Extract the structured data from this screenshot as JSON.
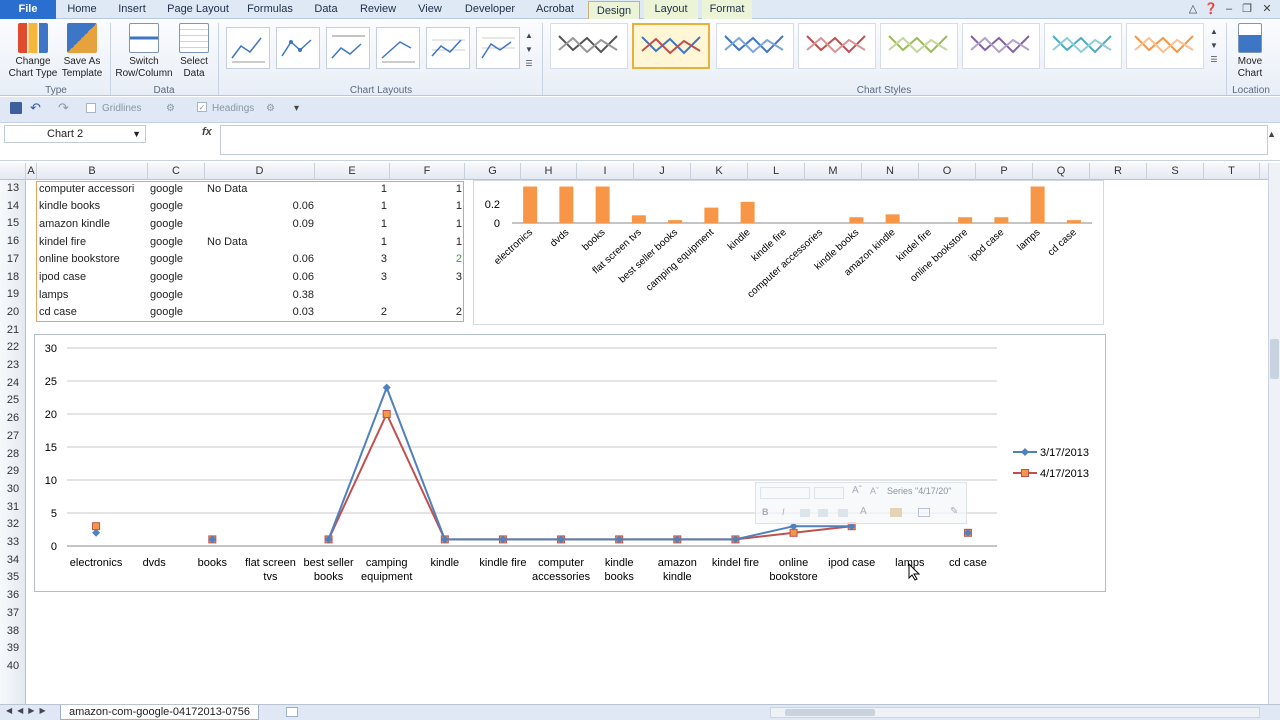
{
  "ribbon": {
    "tabs": [
      "File",
      "Home",
      "Insert",
      "Page Layout",
      "Formulas",
      "Data",
      "Review",
      "View",
      "Developer",
      "Acrobat",
      "Design",
      "Layout",
      "Format"
    ],
    "active_tab": "Design",
    "type_group": {
      "label": "Type",
      "change_chart_type": "Change Chart Type",
      "save_as_template": "Save As Template"
    },
    "data_group": {
      "label": "Data",
      "switch_row_column": "Switch Row/Column",
      "select_data": "Select Data"
    },
    "chart_layouts_label": "Chart Layouts",
    "chart_styles_label": "Chart Styles",
    "location_group": {
      "label": "Location",
      "move_chart": "Move Chart"
    }
  },
  "qat": {
    "gridlines": "Gridlines",
    "headings": "Headings"
  },
  "formula_bar": {
    "name_box": "Chart 2",
    "fx": "fx"
  },
  "columns": [
    "A",
    "B",
    "C",
    "D",
    "E",
    "F",
    "G",
    "H",
    "I",
    "J",
    "K",
    "L",
    "M",
    "N",
    "O",
    "P",
    "Q",
    "R",
    "S",
    "T"
  ],
  "rows": [
    "13",
    "14",
    "15",
    "16",
    "17",
    "18",
    "19",
    "20",
    "21",
    "22",
    "23",
    "24",
    "25",
    "26",
    "27",
    "28",
    "29",
    "30",
    "31",
    "32",
    "33",
    "34",
    "35",
    "36",
    "37",
    "38",
    "39",
    "40"
  ],
  "table": [
    {
      "b": "computer accessori",
      "c": "google",
      "d_text": "No Data",
      "d": "",
      "e": "1",
      "f": "1"
    },
    {
      "b": "kindle books",
      "c": "google",
      "d_text": "",
      "d": "0.06",
      "e": "1",
      "f": "1"
    },
    {
      "b": "amazon kindle",
      "c": "google",
      "d_text": "",
      "d": "0.09",
      "e": "1",
      "f": "1"
    },
    {
      "b": "kindel fire",
      "c": "google",
      "d_text": "No Data",
      "d": "",
      "e": "1",
      "f": "1"
    },
    {
      "b": "online bookstore",
      "c": "google",
      "d_text": "",
      "d": "0.06",
      "e": "3",
      "f": "2"
    },
    {
      "b": "ipod case",
      "c": "google",
      "d_text": "",
      "d": "0.06",
      "e": "3",
      "f": "3"
    },
    {
      "b": "lamps",
      "c": "google",
      "d_text": "",
      "d": "0.38",
      "e": "",
      "f": ""
    },
    {
      "b": "cd case",
      "c": "google",
      "d_text": "",
      "d": "0.03",
      "e": "2",
      "f": "2"
    }
  ],
  "chart_data": [
    {
      "type": "bar",
      "categories": [
        "electronics",
        "dvds",
        "books",
        "flat screen tvs",
        "best seller books",
        "camping equipment",
        "kindle",
        "kindle fire",
        "computer accessories",
        "kindle books",
        "amazon kindle",
        "kindel fire",
        "online bookstore",
        "ipod case",
        "lamps",
        "cd case"
      ],
      "values": [
        0.38,
        0.38,
        0.38,
        0.08,
        0.03,
        0.16,
        0.22,
        0,
        0,
        0.06,
        0.09,
        0,
        0.06,
        0.06,
        0.38,
        0.03
      ],
      "ylim": [
        0,
        0.25
      ],
      "yticks": [
        "0",
        "0.2"
      ],
      "color": "#f79646"
    },
    {
      "type": "line",
      "categories": [
        "electronics",
        "dvds",
        "books",
        "flat screen tvs",
        "best seller books",
        "camping equipment",
        "kindle",
        "kindle fire",
        "computer accessories",
        "kindle books",
        "amazon kindle",
        "kindel fire",
        "online bookstore",
        "ipod case",
        "lamps",
        "cd case"
      ],
      "category_lines": [
        [
          "electronics"
        ],
        [
          "dvds"
        ],
        [
          "books"
        ],
        [
          "flat screen",
          "tvs"
        ],
        [
          "best seller",
          "books"
        ],
        [
          "camping",
          "equipment"
        ],
        [
          "kindle"
        ],
        [
          "kindle fire"
        ],
        [
          "computer",
          "accessories"
        ],
        [
          "kindle",
          "books"
        ],
        [
          "amazon",
          "kindle"
        ],
        [
          "kindel fire"
        ],
        [
          "online",
          "bookstore"
        ],
        [
          "ipod case"
        ],
        [
          "lamps"
        ],
        [
          "cd case"
        ]
      ],
      "series": [
        {
          "name": "3/17/2013",
          "color": "#4f81bd",
          "values": [
            2,
            null,
            1,
            null,
            1,
            24,
            1,
            1,
            1,
            1,
            1,
            1,
            3,
            3,
            null,
            2
          ]
        },
        {
          "name": "4/17/2013",
          "color": "#c0504d",
          "values": [
            3,
            null,
            1,
            null,
            1,
            20,
            1,
            1,
            1,
            1,
            1,
            1,
            2,
            3,
            null,
            2
          ]
        }
      ],
      "ylim": [
        0,
        30
      ],
      "yticks": [
        0,
        5,
        10,
        15,
        20,
        25,
        30
      ],
      "grid": true,
      "legend": "right"
    }
  ],
  "mini_toolbar": {
    "series_label": "Series \"4/17/20\""
  },
  "sheet_tab": "amazon-com-google-04172013-0756"
}
